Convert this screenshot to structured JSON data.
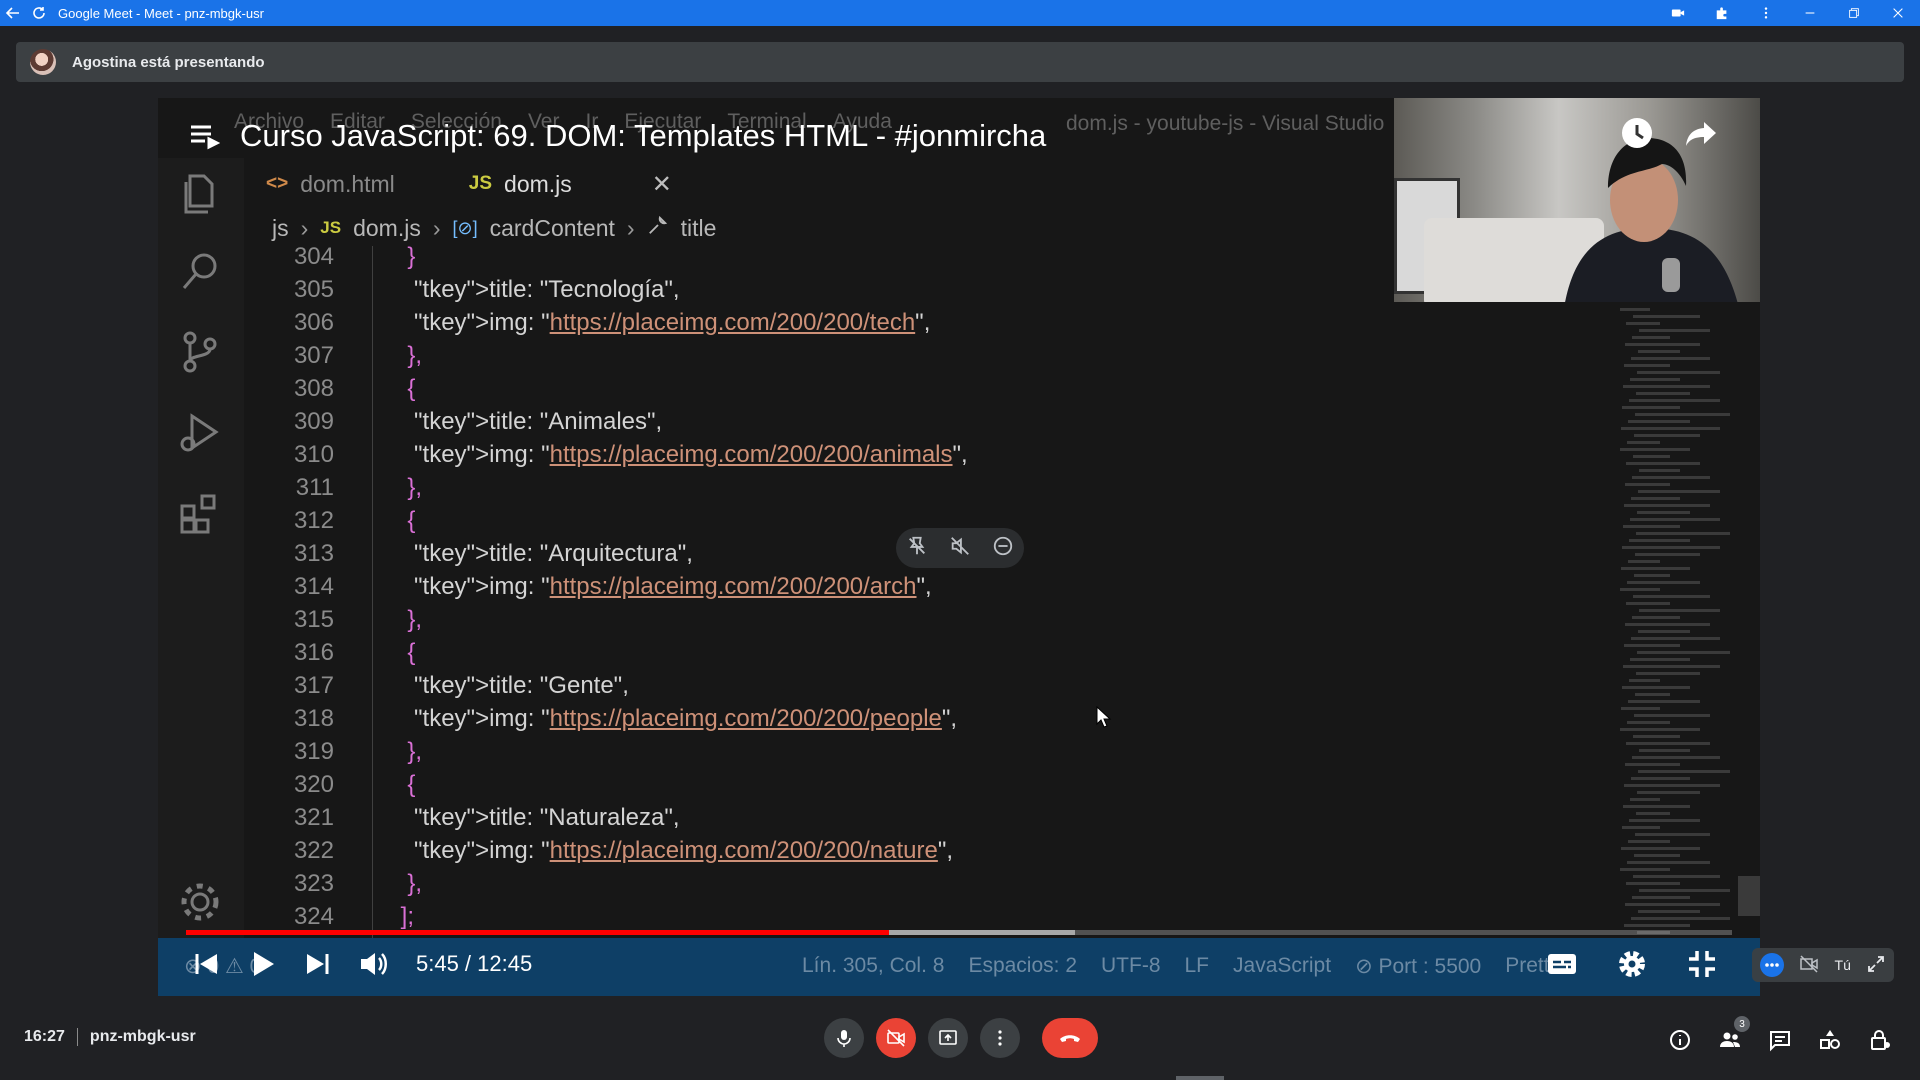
{
  "window": {
    "title": "Google Meet - Meet - pnz-mbgk-usr"
  },
  "banner": {
    "text": "Agostina está presentando"
  },
  "presentation": {
    "video_title": "Curso JavaScript: 69. DOM: Templates HTML - #jonmircha",
    "editor_menu": [
      "Archivo",
      "Editar",
      "Selección",
      "Ver",
      "Ir",
      "Ejecutar",
      "Terminal",
      "Ayuda"
    ],
    "editor_window_title": "dom.js - youtube-js - Visual Studio",
    "tabs": [
      {
        "icon": "<>",
        "label": "dom.html"
      },
      {
        "icon": "JS",
        "label": "dom.js"
      }
    ],
    "tab_close": "✕",
    "breadcrumb": {
      "folder": "js",
      "file_icon": "JS",
      "file": "dom.js",
      "symbol_icon": "[⊘]",
      "symbol": "cardContent",
      "property": "title"
    },
    "code_lines": [
      {
        "n": "304",
        "t": "  }"
      },
      {
        "n": "305",
        "t": "   title: \"Tecnología\","
      },
      {
        "n": "306",
        "t": "   img: \"https://placeimg.com/200/200/tech\","
      },
      {
        "n": "307",
        "t": "  },"
      },
      {
        "n": "308",
        "t": "  {"
      },
      {
        "n": "309",
        "t": "   title: \"Animales\","
      },
      {
        "n": "310",
        "t": "   img: \"https://placeimg.com/200/200/animals\","
      },
      {
        "n": "311",
        "t": "  },"
      },
      {
        "n": "312",
        "t": "  {"
      },
      {
        "n": "313",
        "t": "   title: \"Arquitectura\","
      },
      {
        "n": "314",
        "t": "   img: \"https://placeimg.com/200/200/arch\","
      },
      {
        "n": "315",
        "t": "  },"
      },
      {
        "n": "316",
        "t": "  {"
      },
      {
        "n": "317",
        "t": "   title: \"Gente\","
      },
      {
        "n": "318",
        "t": "   img: \"https://placeimg.com/200/200/people\","
      },
      {
        "n": "319",
        "t": "  },"
      },
      {
        "n": "320",
        "t": "  {"
      },
      {
        "n": "321",
        "t": "   title: \"Naturaleza\","
      },
      {
        "n": "322",
        "t": "   img: \"https://placeimg.com/200/200/nature\","
      },
      {
        "n": "323",
        "t": "  },"
      },
      {
        "n": "324",
        "t": " ];"
      }
    ],
    "status_left": "⊗ 0 ⚠ 0",
    "status_right": [
      "Lín. 305, Col. 8",
      "Espacios: 2",
      "UTF-8",
      "LF",
      "JavaScript",
      "⊘ Port : 5500",
      "Prettier"
    ],
    "player": {
      "time": "5:45 / 12:45",
      "played_fraction": 0.455,
      "buffered_fraction": 0.575
    }
  },
  "self_view": {
    "label": "Tú"
  },
  "bottom": {
    "clock": "16:27",
    "meeting_code": "pnz-mbgk-usr",
    "participants_count": "3"
  },
  "colors": {
    "titlebar": "#1a73e8",
    "end_call": "#ea4335",
    "progress_played": "#ff0000"
  }
}
